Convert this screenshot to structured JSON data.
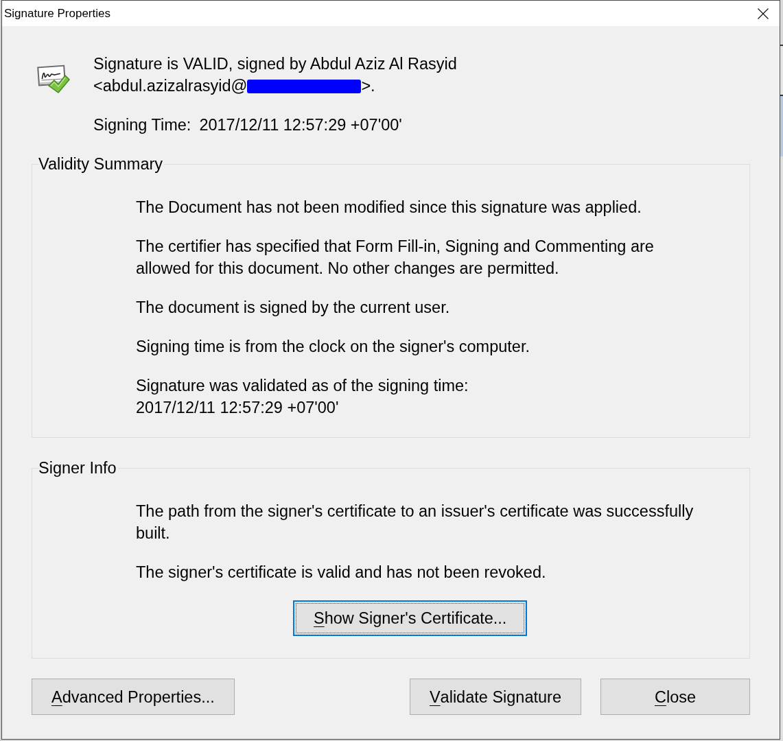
{
  "window": {
    "title": "Signature Properties"
  },
  "header": {
    "status_line": "Signature is VALID, signed by Abdul Aziz Al Rasyid",
    "email_start": "<abdul.azizalrasyid@",
    "email_redacted": true,
    "email_end": ">.",
    "signing_time_label": "Signing Time:",
    "signing_time": "2017/12/11 12:57:29 +07'00'"
  },
  "validity_summary": {
    "title": "Validity Summary",
    "paragraphs": [
      {
        "lines": [
          "The Document has not been modified since this signature was applied."
        ]
      },
      {
        "lines": [
          "The certifier has specified that Form Fill-in, Signing and Commenting are",
          "allowed for this document. No other changes are permitted."
        ]
      },
      {
        "lines": [
          "The document is signed by the current user."
        ]
      },
      {
        "lines": [
          "Signing time is from the clock on the signer's computer."
        ]
      },
      {
        "lines": [
          "Signature was validated as of the signing time:",
          "2017/12/11 12:57:29 +07'00'"
        ]
      }
    ]
  },
  "signer_info": {
    "title": "Signer Info",
    "paragraphs": [
      {
        "lines": [
          "The path from the signer's certificate to an issuer's certificate was successfully",
          "built."
        ]
      },
      {
        "lines": [
          "The signer's certificate is valid and has not been revoked."
        ]
      }
    ],
    "button": {
      "label": [
        {
          "text": "S",
          "underlined": true
        },
        {
          "text": "how Signer's Certificate...",
          "underlined": false
        }
      ],
      "focused": true
    }
  },
  "footer": {
    "left_buttons": [
      {
        "label": [
          {
            "text": "A",
            "underlined": true
          },
          {
            "text": "dvanced Properties...",
            "underlined": false
          }
        ],
        "focused": false
      }
    ],
    "right_buttons": [
      {
        "label": [
          {
            "text": "V",
            "underlined": true
          },
          {
            "text": "alidate Signature",
            "underlined": false
          }
        ],
        "focused": false
      },
      {
        "label": [
          {
            "text": "C",
            "underlined": true
          },
          {
            "text": "lose",
            "underlined": false
          }
        ],
        "focused": false
      }
    ]
  }
}
